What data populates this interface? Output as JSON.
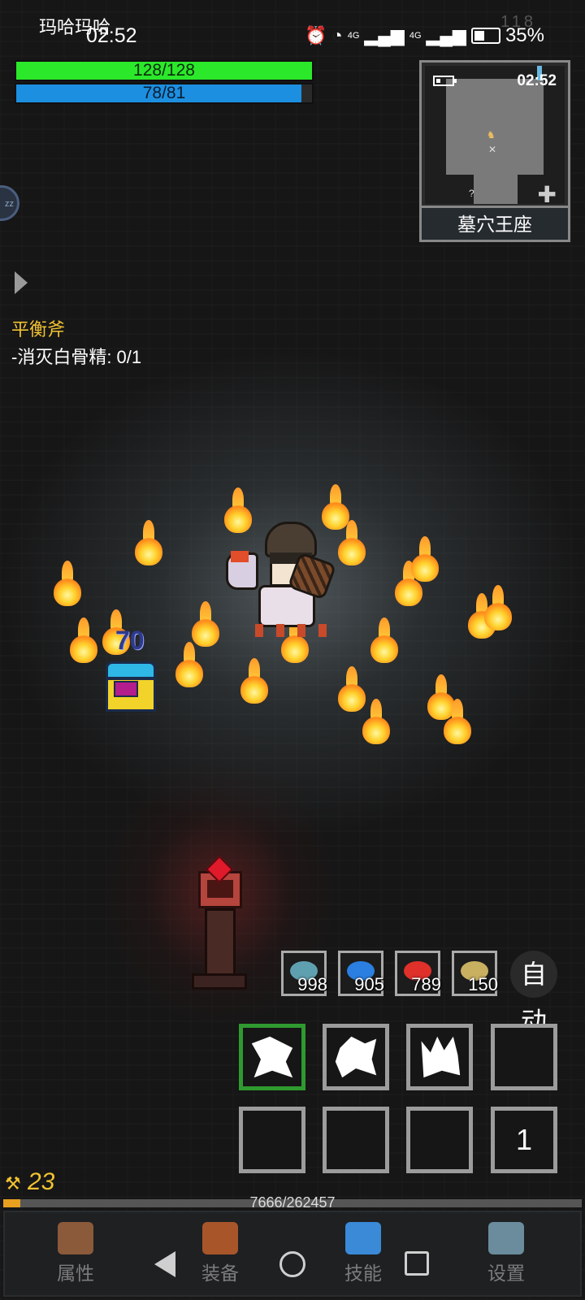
{
  "status_bar": {
    "carrier_name": "玛哈玛哈",
    "time": "02:52",
    "battery": "35%",
    "net_label_1": "4G",
    "net_label_2": "4G",
    "faded_digits": "118"
  },
  "player": {
    "hp_text": "128/128",
    "hp_fraction": 1.0,
    "mp_text": "78/81",
    "mp_fraction": 0.963
  },
  "minimap": {
    "time": "02:52",
    "area_name": "墓穴王座",
    "zoom_icon": "plus-icon"
  },
  "quest": {
    "title": "平衡斧",
    "objective": "-消灭白骨精: 0/1"
  },
  "combat": {
    "damage_number": "70"
  },
  "potions": [
    {
      "name": "fish-icon",
      "count": "998",
      "color": "#5fa0b0"
    },
    {
      "name": "blue-potion-icon",
      "count": "905",
      "color": "#2b7fe0"
    },
    {
      "name": "red-potion-icon",
      "count": "789",
      "color": "#e0302a"
    },
    {
      "name": "scroll-icon",
      "count": "150",
      "color": "#c8b060"
    }
  ],
  "auto_button": "自动",
  "skills": {
    "slot_8_number": "1"
  },
  "level": {
    "value": "23",
    "exp_text": "7666/262457",
    "exp_fraction": 0.029
  },
  "nav": [
    {
      "label": "属性",
      "icon": "helmet-icon",
      "color": "#8a5a3a"
    },
    {
      "label": "装备",
      "icon": "bag-icon",
      "color": "#a8552a"
    },
    {
      "label": "技能",
      "icon": "skill-gem-icon",
      "color": "#3a8ad8"
    },
    {
      "label": "设置",
      "icon": "gear-icon",
      "color": "#6a8c9c"
    }
  ]
}
